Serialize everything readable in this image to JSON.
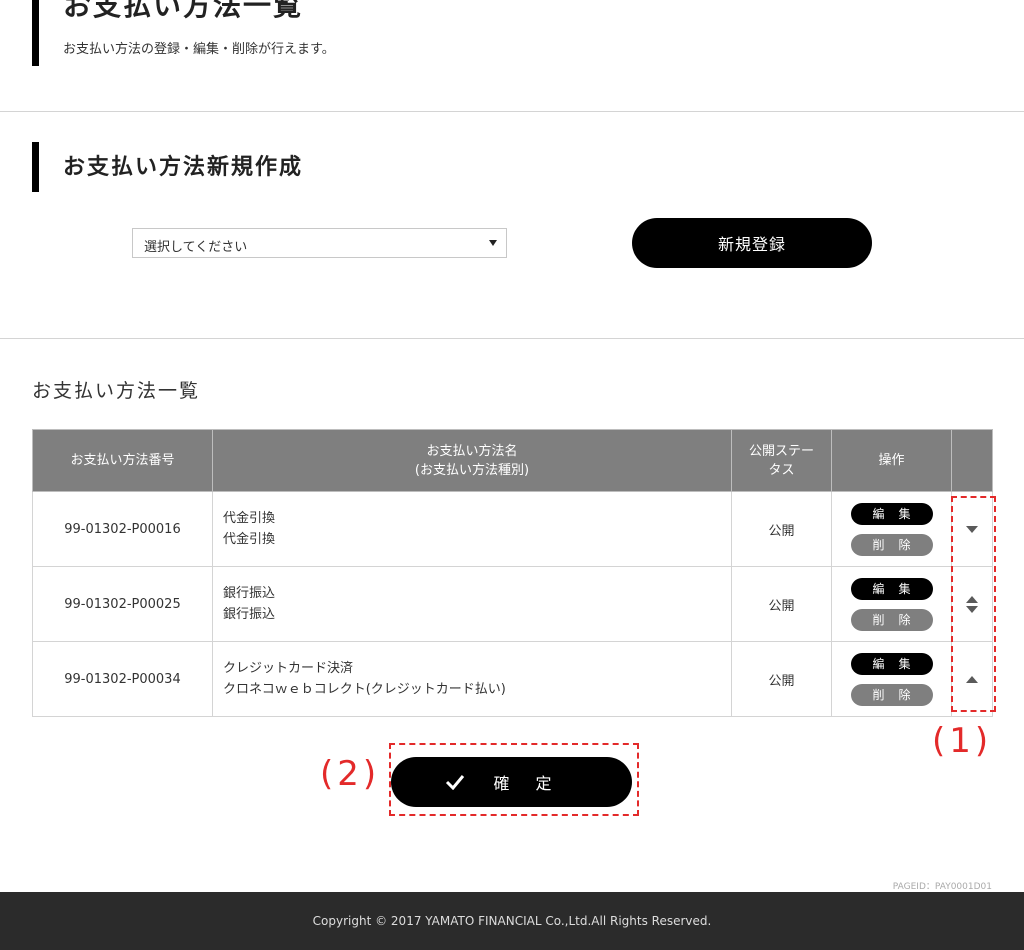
{
  "header": {
    "title": "お支払い方法一覧",
    "subtitle": "お支払い方法の登録・編集・削除が行えます。"
  },
  "create_section": {
    "title": "お支払い方法新規作成",
    "select": {
      "selected": "選択してください"
    },
    "new_button_label": "新規登録"
  },
  "list_section": {
    "title": "お支払い方法一覧",
    "columns": {
      "number": "お支払い方法番号",
      "name_line1": "お支払い方法名",
      "name_line2": "(お支払い方法種別)",
      "status_line1": "公開ステー",
      "status_line2": "タス",
      "operation": "操作",
      "order": ""
    },
    "rows": [
      {
        "number": "99-01302-P00016",
        "name": "代金引換",
        "type": "代金引換",
        "status": "公開",
        "edit": "編集",
        "delete": "削除"
      },
      {
        "number": "99-01302-P00025",
        "name": "銀行振込",
        "type": "銀行振込",
        "status": "公開",
        "edit": "編集",
        "delete": "削除"
      },
      {
        "number": "99-01302-P00034",
        "name": "クレジットカード決済",
        "type": "クロネコｗｅｂコレクト(クレジットカード払い)",
        "status": "公開",
        "edit": "編集",
        "delete": "削除"
      }
    ]
  },
  "annotations": {
    "one": "(1)",
    "two": "(2)"
  },
  "confirm_button_label": "確定",
  "page_id": "PAGEID：PAY0001D01",
  "footer": {
    "copyright": "Copyright © 2017 YAMATO FINANCIAL Co.,Ltd.All Rights Reserved."
  },
  "colors": {
    "primary": "#000000",
    "header_bg": "#7f7f7f",
    "footer_bg": "#2b2b2b",
    "annotation": "#e32a2a"
  }
}
